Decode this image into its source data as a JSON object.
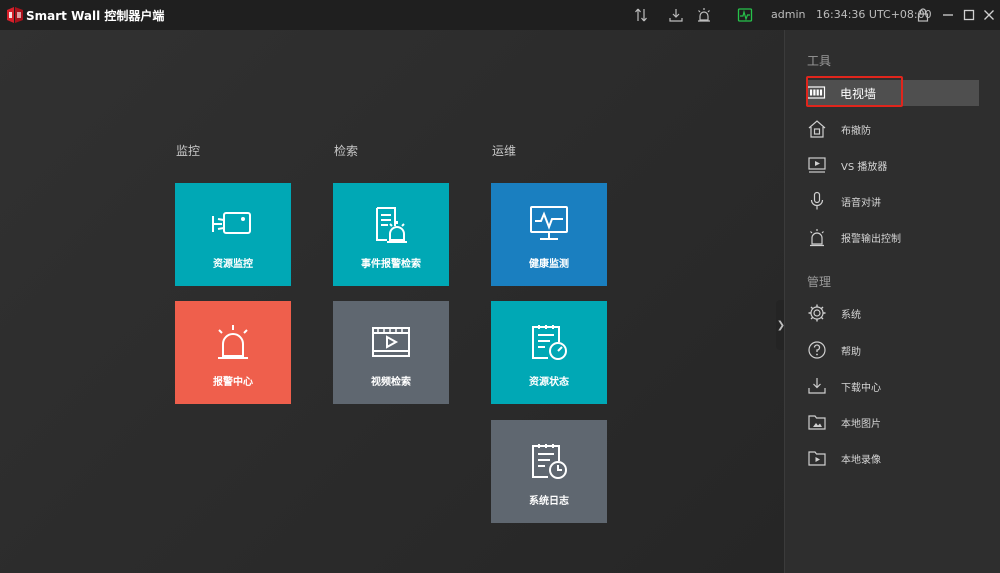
{
  "titlebar": {
    "app_title": "Smart Wall 控制器户端",
    "user": "admin",
    "time": "16:34:36 UTC+08:00",
    "icons": [
      "sort-icon",
      "download-icon",
      "alarm-icon",
      "health-monitor-icon",
      "lock-icon",
      "minimize-icon",
      "maximize-icon",
      "close-icon"
    ]
  },
  "main": {
    "columns": [
      {
        "title": "监控",
        "tiles": [
          {
            "label": "资源监控",
            "icon": "camera-icon",
            "color": "#00a8b5"
          },
          {
            "label": "报警中心",
            "icon": "alarm-light-icon",
            "color": "#ef5f4c"
          }
        ]
      },
      {
        "title": "检索",
        "tiles": [
          {
            "label": "事件报警检索",
            "icon": "event-search-icon",
            "color": "#00a8b5"
          },
          {
            "label": "视频检索",
            "icon": "video-search-icon",
            "color": "#5f6770"
          }
        ]
      },
      {
        "title": "运维",
        "tiles": [
          {
            "label": "健康监测",
            "icon": "health-monitor-icon",
            "color": "#1a7fc0"
          },
          {
            "label": "资源状态",
            "icon": "resource-status-icon",
            "color": "#00a8b5"
          },
          {
            "label": "系统日志",
            "icon": "system-log-icon",
            "color": "#5f6770"
          }
        ]
      }
    ]
  },
  "sidebar": {
    "tools_title": "工具",
    "tools": [
      {
        "label": "电视墙",
        "icon": "video-wall-icon",
        "active": true
      },
      {
        "label": "布撤防",
        "icon": "arm-disarm-icon"
      },
      {
        "label": "VS 播放器",
        "icon": "vs-player-icon"
      },
      {
        "label": "语音对讲",
        "icon": "microphone-icon"
      },
      {
        "label": "报警输出控制",
        "icon": "alarm-output-icon"
      }
    ],
    "manage_title": "管理",
    "manage": [
      {
        "label": "系统",
        "icon": "gear-icon"
      },
      {
        "label": "帮助",
        "icon": "help-icon"
      },
      {
        "label": "下载中心",
        "icon": "download-center-icon"
      },
      {
        "label": "本地图片",
        "icon": "local-picture-icon"
      },
      {
        "label": "本地录像",
        "icon": "local-video-icon"
      }
    ]
  },
  "colors": {
    "accent_teal": "#00a8b5",
    "alarm_orange": "#ef5f4c",
    "tile_grey": "#5f6770",
    "tile_blue": "#1a7fc0",
    "highlight_red": "#e0251c",
    "status_green": "#26c24a"
  }
}
